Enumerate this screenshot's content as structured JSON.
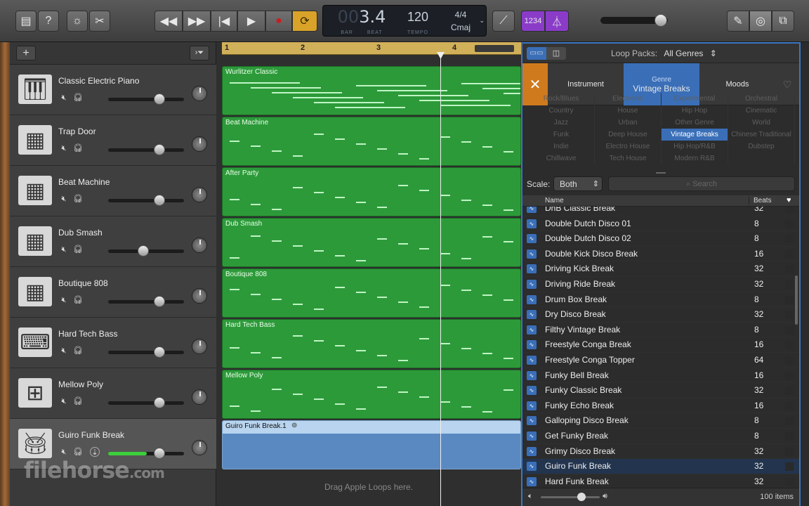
{
  "lcd": {
    "bar_beat": "3.4",
    "ghost": "00",
    "bar_label": "BAR",
    "beat_label": "BEAT",
    "tempo": "120",
    "tempo_label": "TEMPO",
    "signature": "4/4",
    "key": "Cmaj"
  },
  "toolbar": {
    "count_in_label": "1234",
    "colors": {
      "accent": "#8a3cc9",
      "cycle": "#d9a32a",
      "record": "#c81e1e"
    }
  },
  "tracks": [
    {
      "name": "Classic Electric Piano",
      "icon": "piano-icon",
      "volume": 0.75
    },
    {
      "name": "Trap Door",
      "icon": "drum-machine-icon",
      "volume": 0.75
    },
    {
      "name": "Beat Machine",
      "icon": "drum-machine-icon",
      "volume": 0.75
    },
    {
      "name": "Dub Smash",
      "icon": "drum-machine-icon",
      "volume": 0.5
    },
    {
      "name": "Boutique 808",
      "icon": "drum-machine-icon",
      "volume": 0.75
    },
    {
      "name": "Hard Tech Bass",
      "icon": "keyboard-stand-icon",
      "volume": 0.75
    },
    {
      "name": "Mellow Poly",
      "icon": "synth-icon",
      "volume": 0.75
    },
    {
      "name": "Guiro Funk Break",
      "icon": "drum-kit-icon",
      "volume": 0.75
    }
  ],
  "ruler": [
    "1",
    "2",
    "3",
    "4"
  ],
  "regions": [
    "Wurlitzer Classic",
    "Beat Machine",
    "After Party",
    "Dub Smash",
    "Boutique 808",
    "Hard Tech Bass",
    "Mellow Poly",
    "Guiro Funk Break.1"
  ],
  "arrange": {
    "drag_hint": "Drag Apple Loops here."
  },
  "browser": {
    "loop_packs_label": "Loop Packs:",
    "loop_packs_value": "All Genres",
    "categories": {
      "instrument": "Instrument",
      "genre_small": "Genre",
      "genre_value": "Vintage Breaks",
      "moods": "Moods"
    },
    "genres": [
      "Rock/Blues",
      "Electronic",
      "Experimental",
      "Orchestral",
      "Country",
      "House",
      "Hip Hop",
      "Cinematic",
      "Jazz",
      "Urban",
      "Other Genre",
      "World",
      "Funk",
      "Deep House",
      "Vintage Breaks",
      "Chinese Traditional",
      "Indie",
      "Electro House",
      "Hip Hop/R&B",
      "Dubstep",
      "Chillwave",
      "Tech House",
      "Modern R&B",
      ""
    ],
    "scale_label": "Scale:",
    "scale_value": "Both",
    "search_placeholder": "Search",
    "columns": {
      "name": "Name",
      "beats": "Beats"
    },
    "loops": [
      {
        "name": "DnB Classic Break",
        "beats": "32"
      },
      {
        "name": "Double Dutch Disco 01",
        "beats": "8"
      },
      {
        "name": "Double Dutch Disco 02",
        "beats": "8"
      },
      {
        "name": "Double Kick Disco Break",
        "beats": "16"
      },
      {
        "name": "Driving Kick Break",
        "beats": "32"
      },
      {
        "name": "Driving Ride Break",
        "beats": "32"
      },
      {
        "name": "Drum Box Break",
        "beats": "8"
      },
      {
        "name": "Dry Disco Break",
        "beats": "32"
      },
      {
        "name": "Filthy Vintage Break",
        "beats": "8"
      },
      {
        "name": "Freestyle Conga Break",
        "beats": "16"
      },
      {
        "name": "Freestyle Conga Topper",
        "beats": "64"
      },
      {
        "name": "Funky Bell Break",
        "beats": "16"
      },
      {
        "name": "Funky Classic Break",
        "beats": "32"
      },
      {
        "name": "Funky Echo Break",
        "beats": "16"
      },
      {
        "name": "Galloping Disco Break",
        "beats": "8"
      },
      {
        "name": "Get Funky Break",
        "beats": "8"
      },
      {
        "name": "Grimy Disco Break",
        "beats": "32"
      },
      {
        "name": "Guiro Funk Break",
        "beats": "32"
      },
      {
        "name": "Hard Funk Break",
        "beats": "32"
      }
    ],
    "item_count": "100 items"
  },
  "watermark": {
    "brand": "filehorse",
    "tld": ".com"
  }
}
